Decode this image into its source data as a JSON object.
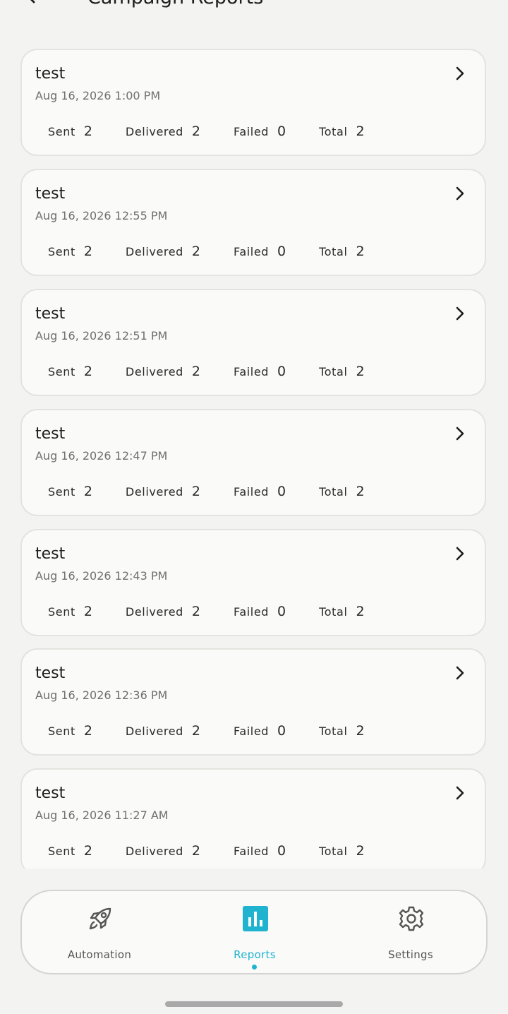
{
  "header": {
    "title": "Campaign Reports"
  },
  "stat_labels": {
    "sent": "Sent",
    "delivered": "Delivered",
    "failed": "Failed",
    "total": "Total"
  },
  "reports": [
    {
      "name": "test",
      "date": "Aug 16, 2026 1:00 PM",
      "sent": "2",
      "delivered": "2",
      "failed": "0",
      "total": "2"
    },
    {
      "name": "test",
      "date": "Aug 16, 2026 12:55 PM",
      "sent": "2",
      "delivered": "2",
      "failed": "0",
      "total": "2"
    },
    {
      "name": "test",
      "date": "Aug 16, 2026 12:51 PM",
      "sent": "2",
      "delivered": "2",
      "failed": "0",
      "total": "2"
    },
    {
      "name": "test",
      "date": "Aug 16, 2026 12:47 PM",
      "sent": "2",
      "delivered": "2",
      "failed": "0",
      "total": "2"
    },
    {
      "name": "test",
      "date": "Aug 16, 2026 12:43 PM",
      "sent": "2",
      "delivered": "2",
      "failed": "0",
      "total": "2"
    },
    {
      "name": "test",
      "date": "Aug 16, 2026 12:36 PM",
      "sent": "2",
      "delivered": "2",
      "failed": "0",
      "total": "2"
    },
    {
      "name": "test",
      "date": "Aug 16, 2026 11:27 AM",
      "sent": "2",
      "delivered": "2",
      "failed": "0",
      "total": "2"
    }
  ],
  "bottom_nav": {
    "items": [
      {
        "label": "Automation",
        "icon": "rocket-icon",
        "active": false
      },
      {
        "label": "Reports",
        "icon": "bar-chart-icon",
        "active": true
      },
      {
        "label": "Settings",
        "icon": "gear-icon",
        "active": false
      }
    ]
  },
  "colors": {
    "accent": "#1fb3cf",
    "background": "#f3f3f1",
    "card": "#fafaf8",
    "text": "#1e1e1e",
    "muted": "#6f6f6f"
  }
}
